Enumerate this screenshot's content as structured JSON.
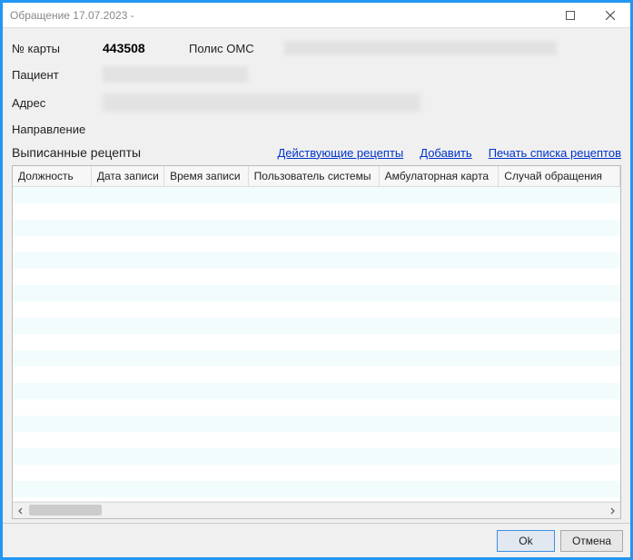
{
  "window": {
    "title": "Обращение 17.07.2023 -"
  },
  "info": {
    "card_label": "№ карты",
    "card_value": "443508",
    "polis_label": "Полис ОМС",
    "patient_label": "Пациент",
    "address_label": "Адрес",
    "direction_label": "Направление"
  },
  "recipes": {
    "title": "Выписанные рецепты",
    "link_active": "Действующие рецепты",
    "link_add": "Добавить",
    "link_print": "Печать списка рецептов"
  },
  "table": {
    "columns": [
      "Должность",
      "Дата записи",
      "Время записи",
      "Пользователь системы",
      "Амбулаторная карта",
      "Случай обращения"
    ]
  },
  "footer": {
    "ok": "Ok",
    "cancel": "Отмена"
  }
}
